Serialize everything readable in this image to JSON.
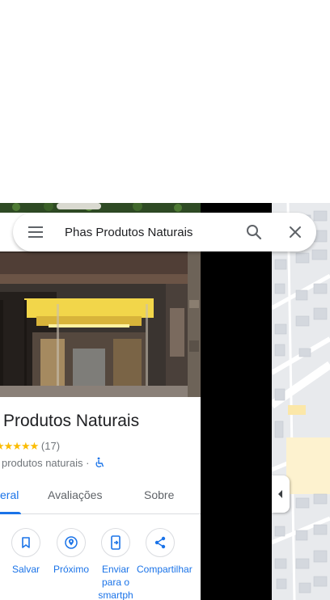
{
  "search": {
    "query": "Phas Produtos Naturais"
  },
  "place": {
    "title": "Produtos Naturais",
    "stars": "★★★★★",
    "rating_count": "(17)",
    "category": "produtos naturais",
    "separator": "·"
  },
  "tabs": [
    {
      "label": "eral",
      "active": true
    },
    {
      "label": "Avaliações",
      "active": false
    },
    {
      "label": "Sobre",
      "active": false
    }
  ],
  "actions": [
    {
      "label": "Salvar",
      "icon": "bookmark-icon"
    },
    {
      "label": "Próximo",
      "icon": "nearby-icon"
    },
    {
      "label": "Enviar para o smartph",
      "icon": "send-to-phone-icon"
    },
    {
      "label": "Compartilhar",
      "icon": "share-icon"
    }
  ],
  "colors": {
    "accent": "#1a73e8",
    "star": "#fbbc04",
    "secondary_text": "#70757a"
  }
}
